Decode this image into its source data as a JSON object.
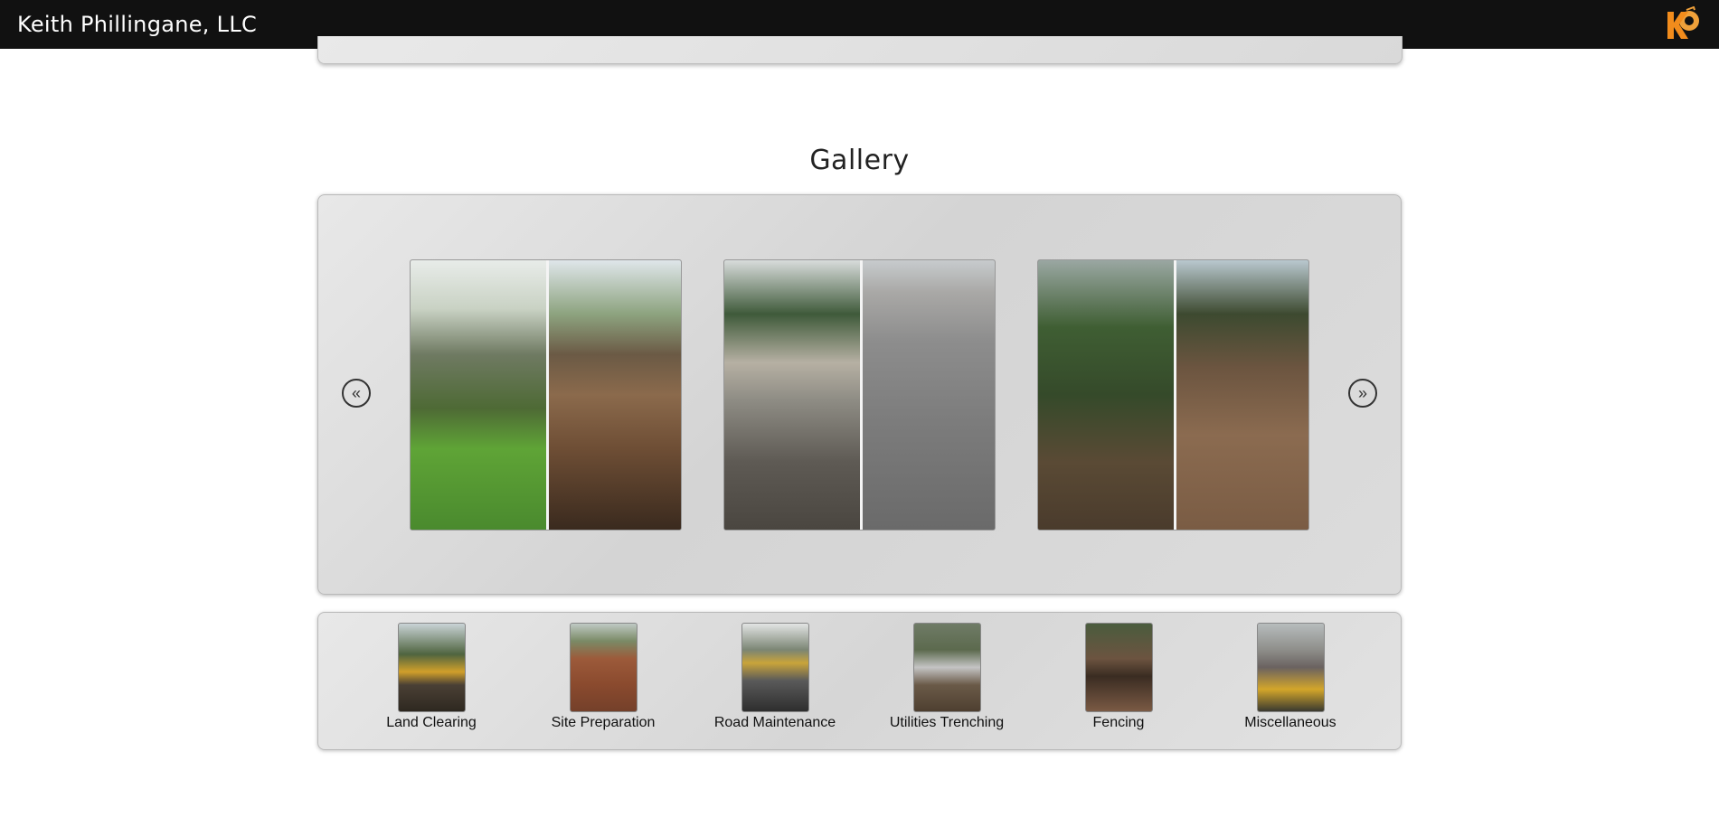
{
  "header": {
    "title": "Keith Phillingane, LLC",
    "logo_icon": "kp-logo-icon"
  },
  "gallery": {
    "title": "Gallery",
    "prev_icon": "double-chevron-left-icon",
    "prev_glyph": "«",
    "next_icon": "double-chevron-right-icon",
    "next_glyph": "»",
    "slides": [
      {
        "name": "before-after-land-clearing-photo"
      },
      {
        "name": "before-after-gravel-road-photo"
      },
      {
        "name": "before-after-brush-removal-photo"
      }
    ]
  },
  "categories": [
    {
      "label": "Land Clearing"
    },
    {
      "label": "Site Preparation"
    },
    {
      "label": "Road Maintenance"
    },
    {
      "label": "Utilities Trenching"
    },
    {
      "label": "Fencing"
    },
    {
      "label": "Miscellaneous"
    }
  ]
}
